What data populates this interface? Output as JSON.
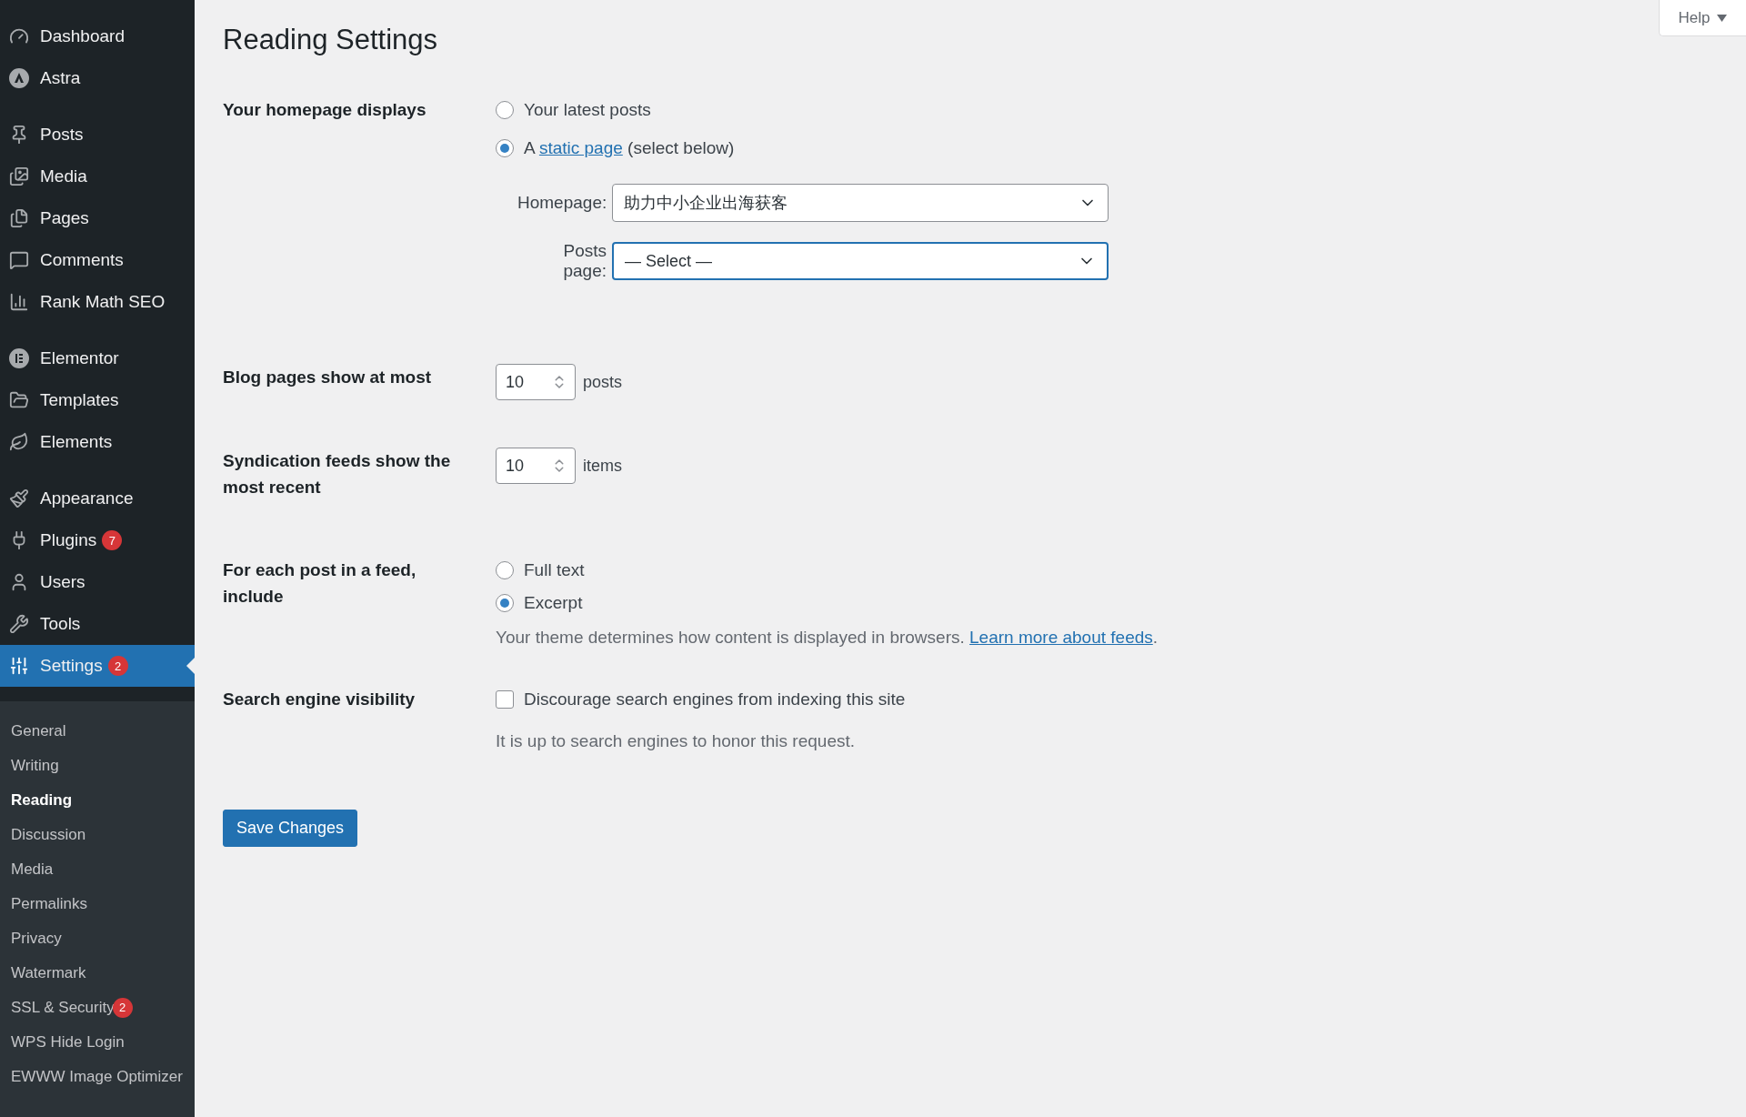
{
  "sidebar": {
    "groups": [
      {
        "items": [
          {
            "label": "Dashboard",
            "selected": false
          },
          {
            "label": "Astra",
            "selected": false
          }
        ]
      },
      {
        "items": [
          {
            "label": "Posts",
            "selected": false
          },
          {
            "label": "Media",
            "selected": false
          },
          {
            "label": "Pages",
            "selected": false
          },
          {
            "label": "Comments",
            "selected": false
          },
          {
            "label": "Rank Math SEO",
            "selected": false
          }
        ]
      },
      {
        "items": [
          {
            "label": "Elementor",
            "selected": false
          },
          {
            "label": "Templates",
            "selected": false
          },
          {
            "label": "Elements",
            "selected": false
          }
        ]
      },
      {
        "items": [
          {
            "label": "Appearance",
            "selected": false
          },
          {
            "label": "Plugins",
            "badge": "7",
            "selected": false
          },
          {
            "label": "Users",
            "selected": false
          },
          {
            "label": "Tools",
            "selected": false
          },
          {
            "label": "Settings",
            "badge": "2",
            "selected": true
          }
        ]
      }
    ],
    "submenu": [
      {
        "label": "General",
        "selected": false
      },
      {
        "label": "Writing",
        "selected": false
      },
      {
        "label": "Reading",
        "selected": true
      },
      {
        "label": "Discussion",
        "selected": false
      },
      {
        "label": "Media",
        "selected": false
      },
      {
        "label": "Permalinks",
        "selected": false
      },
      {
        "label": "Privacy",
        "selected": false
      },
      {
        "label": "Watermark",
        "selected": false
      },
      {
        "label": "SSL & Security",
        "badge": "2",
        "selected": false
      },
      {
        "label": "WPS Hide Login",
        "selected": false
      },
      {
        "label": "EWWW Image Optimizer",
        "selected": false
      }
    ]
  },
  "help": {
    "label": "Help"
  },
  "title": "Reading Settings",
  "homepage_displays": {
    "label": "Your homepage displays",
    "options": [
      {
        "kind": "plain",
        "label": "Your latest posts",
        "selected": false
      },
      {
        "kind": "link",
        "before": "A",
        "link": "static page",
        "after": "(select below)",
        "selected": true
      }
    ],
    "selects": [
      {
        "label": "Homepage:",
        "value": "助力中小企业出海获客",
        "focused": false
      },
      {
        "label": "Posts page:",
        "value": "— Select —",
        "focused": true
      }
    ]
  },
  "numbers": [
    {
      "label": "Blog pages show at most",
      "value": "10",
      "unit": "posts"
    },
    {
      "label": "Syndication feeds show the most recent",
      "value": "10",
      "unit": "items"
    }
  ],
  "feed": {
    "label": "For each post in a feed, include",
    "options": [
      {
        "label": "Full text",
        "selected": false
      },
      {
        "label": "Excerpt",
        "selected": true
      }
    ],
    "description": "Your theme determines how content is displayed in browsers.",
    "link": "Learn more about feeds",
    "after": "."
  },
  "visibility": {
    "label": "Search engine visibility",
    "checkbox": {
      "label": "Discourage search engines from indexing this site",
      "checked": false
    },
    "description": "It is up to search engines to honor this request."
  },
  "save_button": "Save Changes"
}
